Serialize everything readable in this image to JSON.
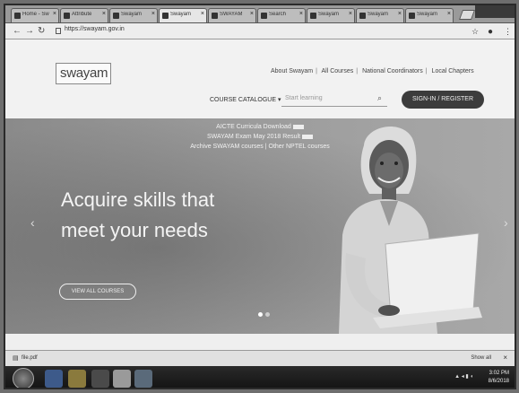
{
  "browser": {
    "tabs": [
      {
        "label": "Home - Sw"
      },
      {
        "label": "Attribute"
      },
      {
        "label": "Swayam"
      },
      {
        "label": "Swayam"
      },
      {
        "label": "SWAYAM"
      },
      {
        "label": "Search"
      },
      {
        "label": "Swayam"
      },
      {
        "label": "Swayam"
      },
      {
        "label": "Swayam"
      }
    ],
    "url": "https://swayam.gov.in"
  },
  "site": {
    "logo_text": "swayam",
    "topnav": [
      "About Swayam",
      "All Courses",
      "National Coordinators",
      "Local Chapters"
    ],
    "catalogue_label": "COURSE CATALOGUE",
    "search_placeholder": "Start learning",
    "signin_label": "SIGN-IN / REGISTER"
  },
  "hero": {
    "notices": [
      "AICTE Curricula Download",
      "SWAYAM Exam May 2018 Result",
      "Archive SWAYAM courses | Other NPTEL courses"
    ],
    "headline_line1": "Acquire skills that",
    "headline_line2": "meet your needs",
    "cta_label": "VIEW ALL COURSES",
    "slide_count": 2,
    "active_slide": 1
  },
  "download_bar": {
    "item": "file.pdf",
    "show_all": "Show all"
  },
  "taskbar": {
    "time": "3:02 PM",
    "date": "8/6/2018"
  }
}
